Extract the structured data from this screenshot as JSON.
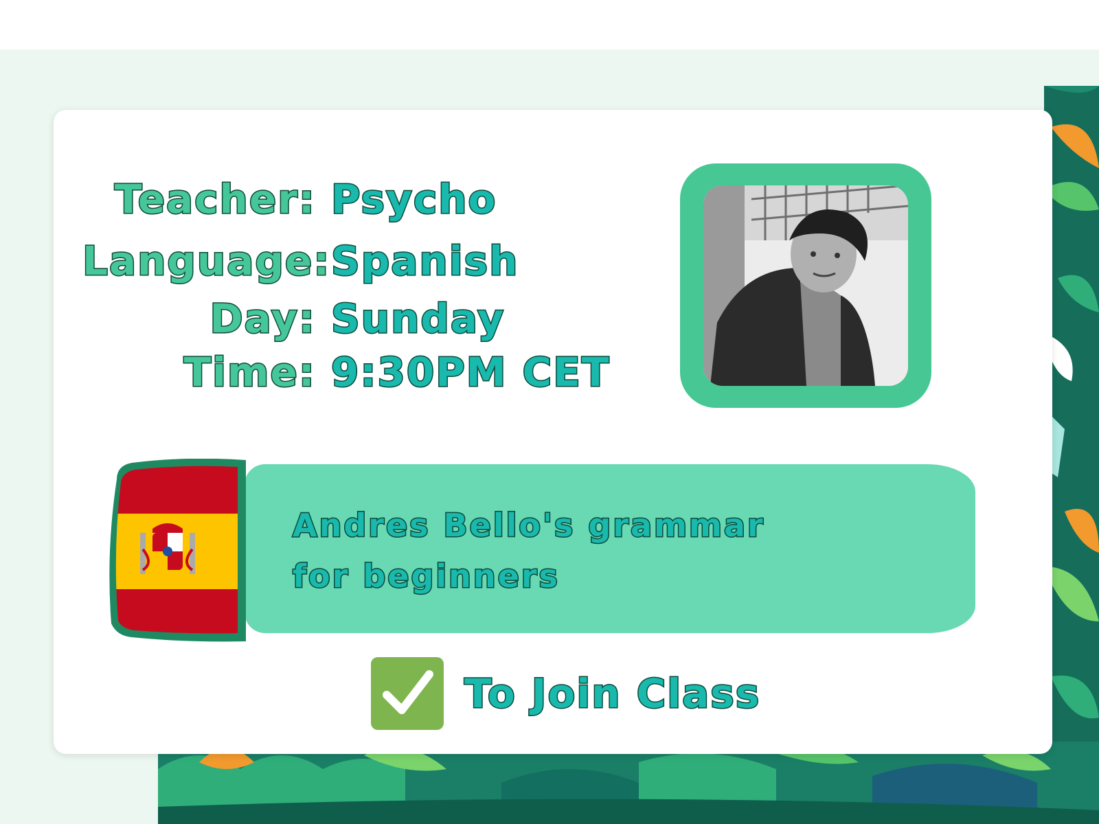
{
  "info": {
    "teacher_label": "Teacher:",
    "teacher_value": "Psycho",
    "language_label": "Language:",
    "language_value": "Spanish",
    "day_label": "Day:",
    "day_value": "Sunday",
    "time_label": "Time:",
    "time_value": "9:30PM CET"
  },
  "course": {
    "title_line1": "Andres Bello's grammar",
    "title_line2": "for beginners"
  },
  "join": {
    "label": "To Join Class"
  },
  "colors": {
    "accent_green": "#46c79a",
    "text_teal": "#19b9ad",
    "bar_mint": "#68d9b3",
    "flag_red": "#c60b1e",
    "flag_yellow": "#ffc400",
    "check_green": "#7fb54f"
  },
  "icons": {
    "flag": "spain-flag-icon",
    "join": "checkmark-icon"
  }
}
